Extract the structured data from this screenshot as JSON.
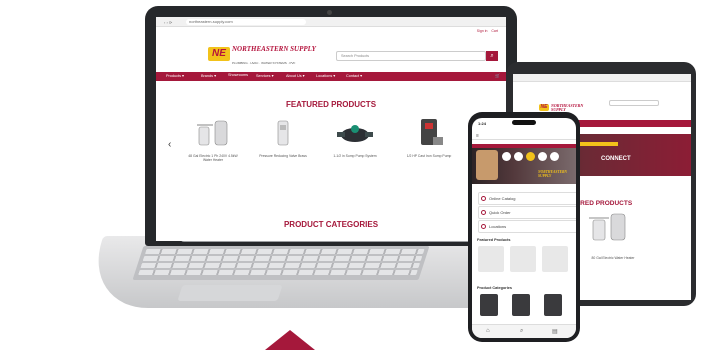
{
  "laptop": {
    "url": "northeastern-supply.com",
    "top_links": [
      "Sign in",
      "Cart"
    ],
    "logo_text": "NORTHEASTERN SUPPLY",
    "logo_badge": "NE",
    "tagline": "PLUMBING · HVAC · WATER SYSTEMS · PVF",
    "search_placeholder": "Search Products",
    "nav_items": [
      "Products ▾",
      "Brands ▾",
      "Showrooms",
      "Services ▾",
      "About Us ▾",
      "Locations ▾",
      "Contact ▾"
    ],
    "featured_title": "FEATURED PRODUCTS",
    "products": [
      {
        "caption": "48 Gal Electric 1 Ph 240V 4.5kW Water Heater",
        "icon": "water-heater-icon"
      },
      {
        "caption": "Pressure Reducing Valve Brass",
        "icon": "valve-icon"
      },
      {
        "caption": "1-1/2 in Sump Pump System",
        "icon": "pump-icon"
      },
      {
        "caption": "1/2 HP Cast Iron Sump Pump",
        "icon": "sump-pump-icon"
      }
    ],
    "categories_title": "PRODUCT CATEGORIES",
    "prev_arrow": "‹"
  },
  "tablet": {
    "logo_text": "NORTHEASTERN SUPPLY",
    "banner_text": "CONNECT",
    "featured_title": "FEATURED PRODUCTS",
    "product_caption": "80 Gal Electric Water Heater"
  },
  "phone": {
    "time": "1:24",
    "hero_text": "NORTHEASTERN SUPPLY",
    "menu": [
      "Online Catalog",
      "Quick Order",
      "Locations"
    ],
    "featured_label": "Featured Products",
    "categories_label": "Product Categories"
  },
  "colors": {
    "brand": "#a5183b",
    "accent": "#f2c21a",
    "device": "#26282b"
  }
}
